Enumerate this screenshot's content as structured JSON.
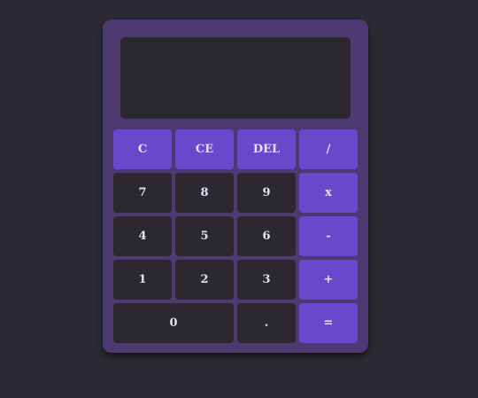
{
  "colors": {
    "page_background": "#2d2a33",
    "calculator_body": "#4d3a73",
    "display_background": "#2b2830",
    "number_key": "#2b2830",
    "accent_key": "#6a48cc",
    "key_text": "#e6e0f2"
  },
  "display": {
    "value": ""
  },
  "keys": {
    "clear": "C",
    "clear_entry": "CE",
    "delete": "DEL",
    "divide": "/",
    "seven": "7",
    "eight": "8",
    "nine": "9",
    "multiply": "x",
    "four": "4",
    "five": "5",
    "six": "6",
    "subtract": "-",
    "one": "1",
    "two": "2",
    "three": "3",
    "add": "+",
    "zero": "0",
    "decimal": ".",
    "equals": "="
  }
}
